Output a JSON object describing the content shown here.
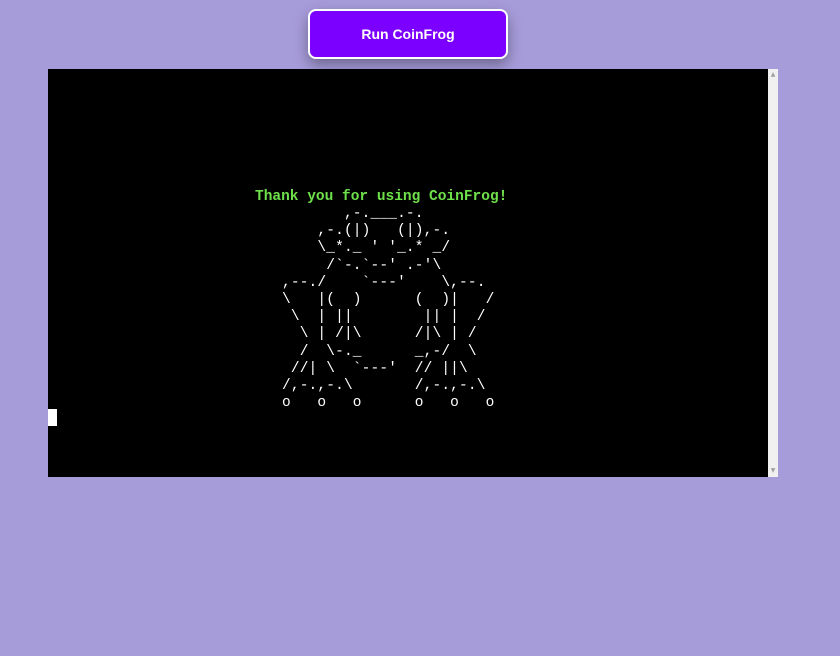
{
  "toolbar": {
    "run_label": "Run CoinFrog"
  },
  "terminal": {
    "message": "Thank you for using CoinFrog!",
    "art": "       ,-.___.-.\n    ,-.(|)   (|),-.\n    \\_*._ ' '_.* _/\n     /`-.`--' .-'\\\n,--./    `---'    \\,--.\n\\   |(  )      (  )|   /\n \\  | ||        || |  /\n  \\ | /|\\      /|\\ | /\n  /  \\-._      _,-/  \\\n //| \\  `---'  // ||\\\n/,-.,-.\\       /,-.,-.\\\no   o   o      o   o   o",
    "colors": {
      "background": "#000000",
      "message": "#6ee04a",
      "art": "#ffffff"
    }
  },
  "page": {
    "background": "#a79cda",
    "accent": "#7b00ff"
  }
}
